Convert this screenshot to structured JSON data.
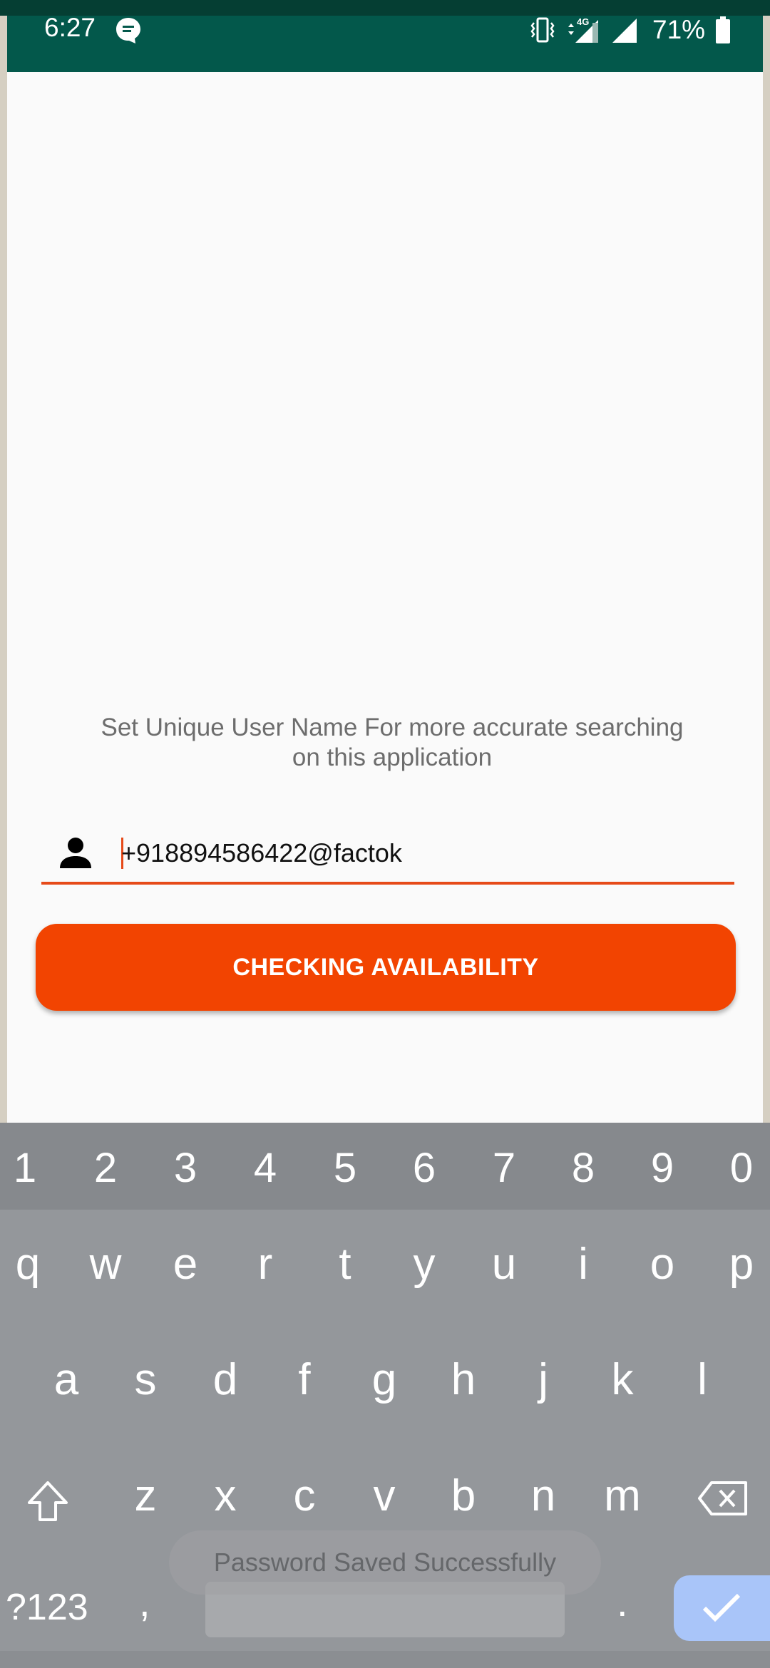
{
  "status_bar": {
    "time": "6:27",
    "network": "4G",
    "battery_percent": "71%",
    "icons": [
      "chat-notification-icon",
      "vibrate-icon",
      "mobile-signal-4g-icon",
      "wifi-signal-icon",
      "battery-icon"
    ]
  },
  "main": {
    "hint_line1": "Set Unique User Name For more accurate searching",
    "hint_line2": "on this application",
    "username_value": "+918894586422@factok",
    "action_button_label": "CHECKING AVAILABILITY"
  },
  "keyboard": {
    "number_row": [
      "1",
      "2",
      "3",
      "4",
      "5",
      "6",
      "7",
      "8",
      "9",
      "0"
    ],
    "row1": [
      "q",
      "w",
      "e",
      "r",
      "t",
      "y",
      "u",
      "i",
      "o",
      "p"
    ],
    "row2": [
      "a",
      "s",
      "d",
      "f",
      "g",
      "h",
      "j",
      "k",
      "l"
    ],
    "row3": [
      "z",
      "x",
      "c",
      "v",
      "b",
      "n",
      "m"
    ],
    "symbols_label": "?123",
    "comma": ",",
    "period": "."
  },
  "toast": "Password Saved Successfully",
  "colors": {
    "status_bar": "#03584b",
    "accent": "#f24401",
    "input_underline": "#e64a19",
    "keyboard_bg": "#94979b",
    "done_key": "#a9c5f9"
  }
}
